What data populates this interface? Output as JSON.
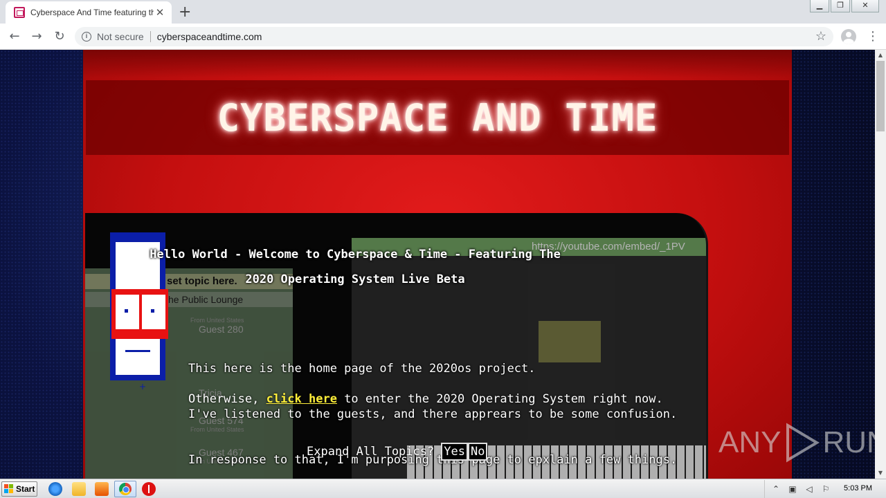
{
  "browser": {
    "tab_title": "Cyberspace And Time featuring the",
    "tab_close": "✕",
    "new_tab": "+",
    "security_label": "Not secure",
    "url": "cyberspaceandtime.com"
  },
  "page": {
    "banner_title": "CYBERSPACE AND TIME",
    "headline_line1": "Hello World - Welcome to Cyberspace & Time - Featuring The",
    "headline_line2": "2020 Operating System Live Beta",
    "intro_line1": "This here is the home page of the 2020os project.",
    "intro_line2": "I've listened to the guests, and there apprears to be some confusion.",
    "intro_line3": "In response to that, I'm purposing this page to epxlain a few things.",
    "otherwise_prefix": "Otherwise, ",
    "link_text": "click here",
    "otherwise_suffix": " to enter the 2020 Operating System right now.",
    "expand_label": "Expand All Topics?",
    "yes_label": "Yes",
    "no_label": "No"
  },
  "background_collage": {
    "chat_title": "set topic here.",
    "chat_sub": "he Public Lounge",
    "guests": [
      {
        "name": "Guest 280",
        "from": "From United States"
      },
      {
        "name": "Tricia",
        "from": ""
      },
      {
        "name": "Guest 574",
        "from": "From United States"
      },
      {
        "name": "Guest 467",
        "from": "From United States"
      }
    ],
    "video_url": "https://youtube.com/embed/_1PV"
  },
  "watermark": {
    "left": "ANY",
    "right": "RUN"
  },
  "taskbar": {
    "start_label": "Start",
    "clock": "5:03 PM"
  },
  "colors": {
    "page_red": "#c40f0f",
    "link_yellow": "#ffef3a",
    "mascot_blue": "#0b1ea8",
    "mascot_red": "#e81212"
  }
}
